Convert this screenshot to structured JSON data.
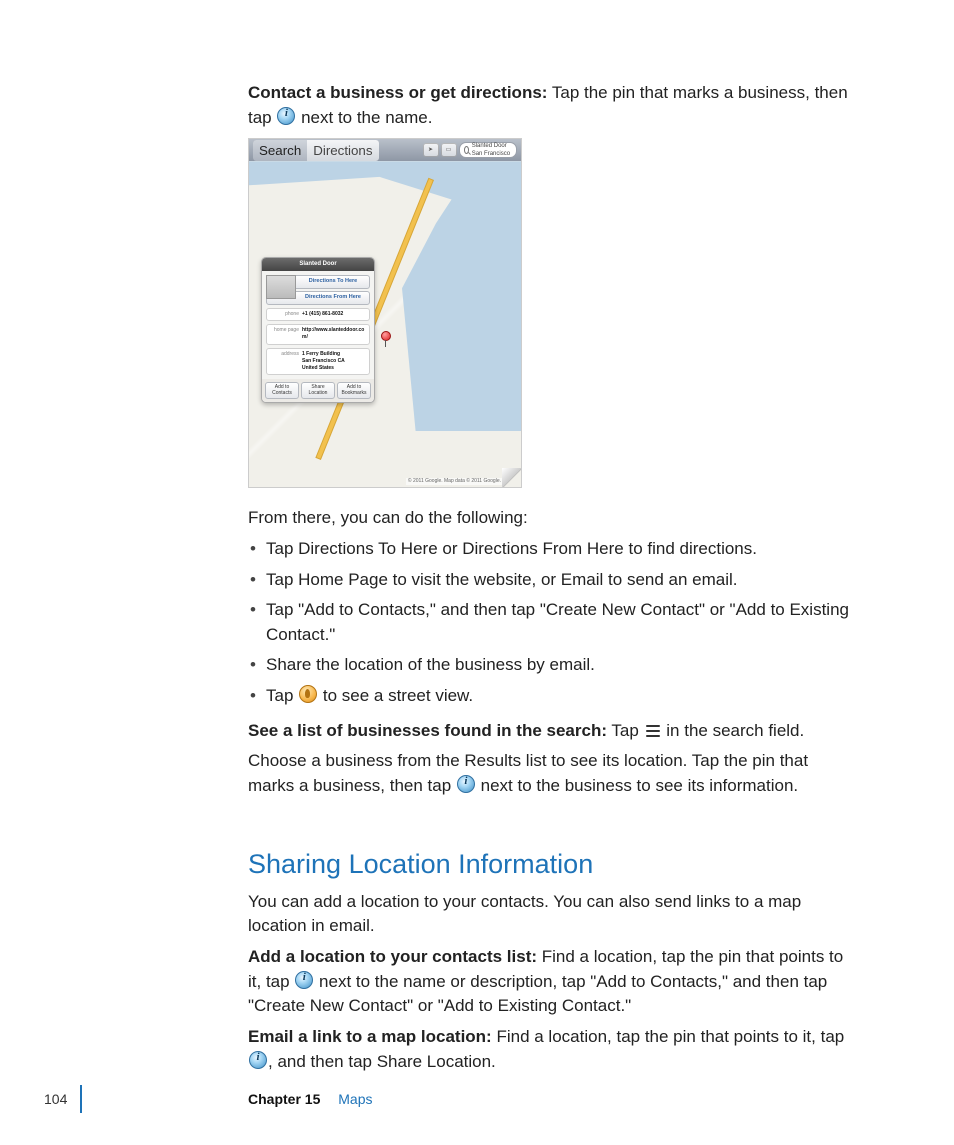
{
  "intro": {
    "lead": "Contact a business or get directions:",
    "text_a": "  Tap the pin that marks a business, then tap ",
    "text_b": " next to the name."
  },
  "figure": {
    "toolbar": {
      "seg_search": "Search",
      "seg_directions": "Directions",
      "search_value": "Slanted Door San Francisco"
    },
    "popup": {
      "title": "Slanted Door",
      "dir_to": "Directions To Here",
      "dir_from": "Directions From Here",
      "phone_label": "phone",
      "phone": "+1 (415) 861-8032",
      "homepage_label": "home page",
      "homepage": "http://www.slanteddoor.com/",
      "address_label": "address",
      "address": "1 Ferry Building\nSan Francisco CA\nUnited States",
      "action_add_contacts": "Add to\nContacts",
      "action_share": "Share\nLocation",
      "action_add_bookmarks": "Add to\nBookmarks"
    },
    "attribution": "© 2011 Google. Map data © 2011 Google."
  },
  "after_figure": "From there, you can do the following:",
  "bullets": [
    "Tap Directions To Here or Directions From Here to find directions.",
    "Tap Home Page to visit the website, or Email to send an email.",
    "Tap \"Add to Contacts,\" and then tap \"Create New Contact\" or \"Add to Existing Contact.\"",
    "Share the location of the business by email."
  ],
  "bullet5_a": "Tap ",
  "bullet5_b": " to see a street view.",
  "see_list": {
    "lead": "See a list of businesses found in the search:",
    "a": "  Tap ",
    "b": " in the search field."
  },
  "choose": {
    "a": "Choose a business from the Results list to see its location. Tap the pin that marks a business, then tap ",
    "b": " next to the business to see its information."
  },
  "section_heading": "Sharing Location Information",
  "sharing_intro": "You can add a location to your contacts. You can also send links to a map location in email.",
  "add_location": {
    "lead": "Add a location to your contacts list:",
    "a": "  Find a location, tap the pin that points to it, tap ",
    "b": " next to the name or description, tap \"Add to Contacts,\" and then tap \"Create New Contact\" or \"Add to Existing Contact.\""
  },
  "email_link": {
    "lead": "Email a link to a map location:",
    "a": "  Find a location, tap the pin that points to it, tap ",
    "b": ", and then tap Share Location."
  },
  "footer": {
    "page": "104",
    "chapter_label": "Chapter 15",
    "chapter_title": "Maps"
  }
}
